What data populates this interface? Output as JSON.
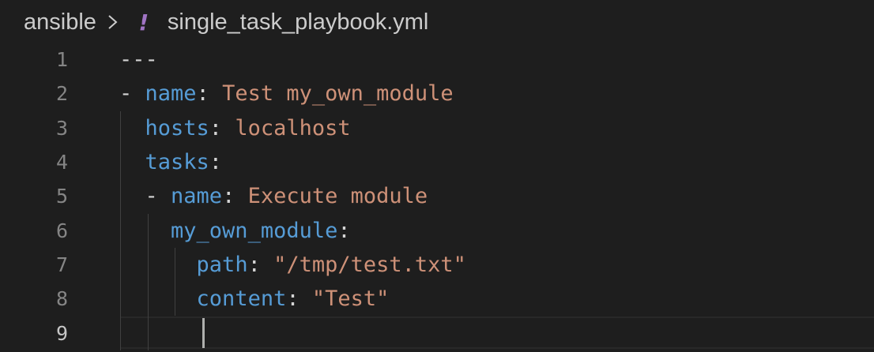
{
  "breadcrumb": {
    "folder": "ansible",
    "separator_icon": "chevron-right-icon",
    "file_icon": "yaml-exclamation-icon",
    "file_icon_glyph": "!",
    "file": "single_task_playbook.yml"
  },
  "colors": {
    "background": "#1e1e1e",
    "key": "#569cd6",
    "string": "#ce9178",
    "punctuation": "#d4d4d4",
    "line_number": "#858585",
    "line_number_active": "#c6c6c6",
    "yaml_icon": "#a074c4"
  },
  "editor": {
    "active_line": 9,
    "lines": [
      {
        "number": "1",
        "tokens": [
          {
            "t": "p",
            "text": "---"
          }
        ]
      },
      {
        "number": "2",
        "tokens": [
          {
            "t": "p",
            "text": "- "
          },
          {
            "t": "k",
            "text": "name"
          },
          {
            "t": "p",
            "text": ": "
          },
          {
            "t": "v",
            "text": "Test my_own_module"
          }
        ]
      },
      {
        "number": "3",
        "tokens": [
          {
            "t": "p",
            "text": "  "
          },
          {
            "t": "k",
            "text": "hosts"
          },
          {
            "t": "p",
            "text": ": "
          },
          {
            "t": "v",
            "text": "localhost"
          }
        ]
      },
      {
        "number": "4",
        "tokens": [
          {
            "t": "p",
            "text": "  "
          },
          {
            "t": "k",
            "text": "tasks"
          },
          {
            "t": "p",
            "text": ":"
          }
        ]
      },
      {
        "number": "5",
        "tokens": [
          {
            "t": "p",
            "text": "  - "
          },
          {
            "t": "k",
            "text": "name"
          },
          {
            "t": "p",
            "text": ": "
          },
          {
            "t": "v",
            "text": "Execute module"
          }
        ]
      },
      {
        "number": "6",
        "tokens": [
          {
            "t": "p",
            "text": "    "
          },
          {
            "t": "k",
            "text": "my_own_module"
          },
          {
            "t": "p",
            "text": ":"
          }
        ]
      },
      {
        "number": "7",
        "tokens": [
          {
            "t": "p",
            "text": "      "
          },
          {
            "t": "k",
            "text": "path"
          },
          {
            "t": "p",
            "text": ": "
          },
          {
            "t": "v",
            "text": "\"/tmp/test.txt\""
          }
        ]
      },
      {
        "number": "8",
        "tokens": [
          {
            "t": "p",
            "text": "      "
          },
          {
            "t": "k",
            "text": "content"
          },
          {
            "t": "p",
            "text": ": "
          },
          {
            "t": "v",
            "text": "\"Test\""
          }
        ]
      },
      {
        "number": "9",
        "tokens": []
      }
    ]
  }
}
